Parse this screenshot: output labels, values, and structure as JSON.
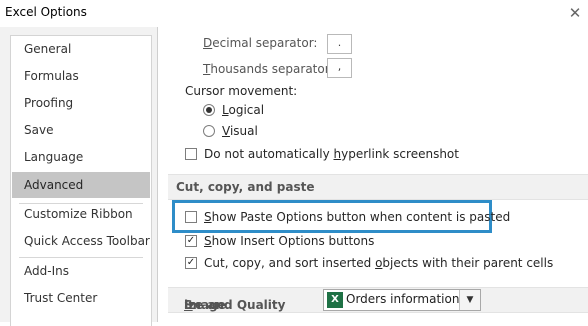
{
  "window": {
    "title": "Excel Options",
    "close_glyph": "✕"
  },
  "nav": {
    "items": [
      {
        "label": "General"
      },
      {
        "label": "Formulas"
      },
      {
        "label": "Proofing"
      },
      {
        "label": "Save"
      },
      {
        "label": "Language"
      },
      {
        "label": "Advanced",
        "selected": true
      },
      {
        "label": "Customize Ribbon"
      },
      {
        "label": "Quick Access Toolbar"
      },
      {
        "label": "Add-Ins"
      },
      {
        "label": "Trust Center"
      }
    ]
  },
  "separators": {
    "decimal": {
      "label_u": "D",
      "label_rest": "ecimal separator:",
      "value": "."
    },
    "thousands": {
      "label_u": "T",
      "label_rest": "housands separator:",
      "value": ","
    }
  },
  "cursor": {
    "heading": "Cursor movement:",
    "logical": {
      "label_u": "L",
      "label_rest": "ogical",
      "checked": true
    },
    "visual": {
      "label_u": "V",
      "label_rest": "isual",
      "checked": false
    }
  },
  "hyperlink": {
    "pre": "Do not automatically ",
    "u": "h",
    "post": "yperlink screenshot",
    "checked": false
  },
  "section_cut": {
    "title": "Cut, copy, and paste"
  },
  "paste_options": {
    "pre": "",
    "u": "S",
    "post": "how Paste Options button when content is pasted",
    "checked": false
  },
  "insert_options": {
    "pre": "",
    "u": "S",
    "post": "how Insert Options buttons",
    "checked": true
  },
  "cut_copy_sort": {
    "pre": "Cut, copy, and sort inserted ",
    "u": "o",
    "post": "bjects with their parent cells",
    "checked": true
  },
  "image_size": {
    "title_pre": "Image ",
    "title_u": "S",
    "title_post": "ize and Quality",
    "dropdown_value": "Orders information...",
    "dropdown_icon": "X",
    "arrow_glyph": "▼"
  },
  "colors": {
    "highlight": "#2e8dc8",
    "nav_selected": "#c5c5c5",
    "excel_green": "#1e7145"
  }
}
